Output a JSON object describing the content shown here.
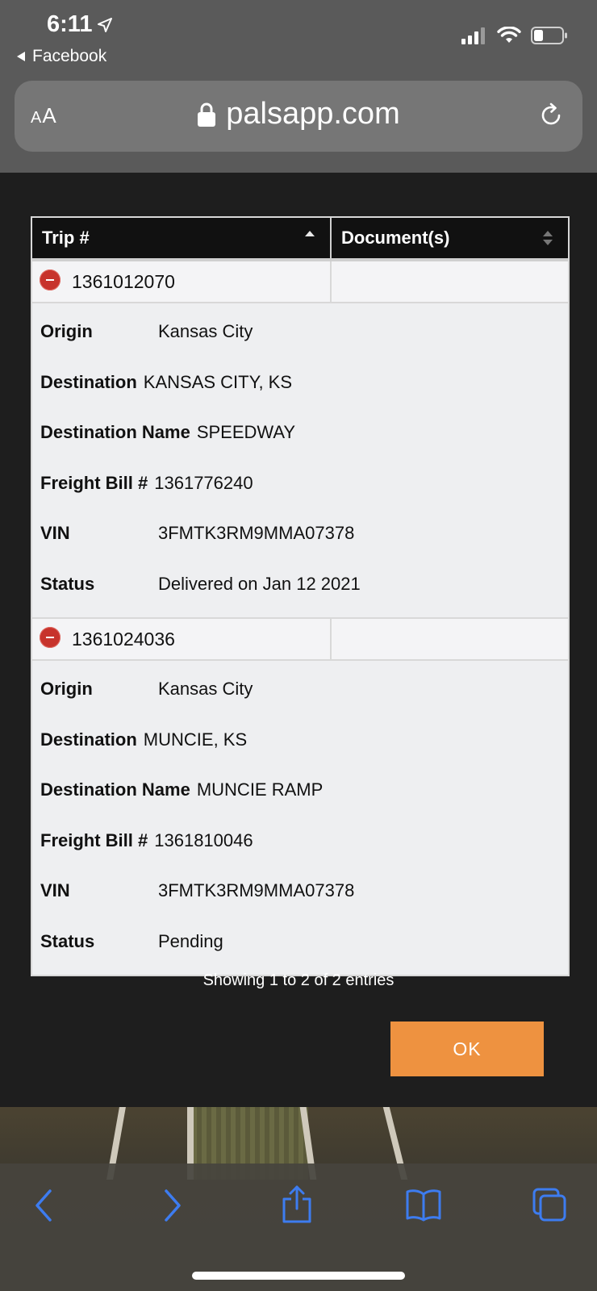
{
  "status_bar": {
    "time": "6:11",
    "back_app": "Facebook"
  },
  "browser": {
    "text_size_label_small": "A",
    "text_size_label_large": "A",
    "url": "palsapp.com"
  },
  "table": {
    "headers": {
      "trip": "Trip #",
      "documents": "Document(s)"
    },
    "trips": [
      {
        "trip_number": "1361012070",
        "details": [
          {
            "label": "Origin",
            "value": "Kansas City"
          },
          {
            "label": "Destination",
            "value": "KANSAS CITY, KS"
          },
          {
            "label": "Destination Name",
            "value": "SPEEDWAY"
          },
          {
            "label": "Freight Bill #",
            "value": "1361776240"
          },
          {
            "label": "VIN",
            "value": "3FMTK3RM9MMA07378"
          },
          {
            "label": "Status",
            "value": "Delivered on Jan 12 2021"
          }
        ]
      },
      {
        "trip_number": "1361024036",
        "details": [
          {
            "label": "Origin",
            "value": "Kansas City"
          },
          {
            "label": "Destination",
            "value": "MUNCIE, KS"
          },
          {
            "label": "Destination Name",
            "value": "MUNCIE RAMP"
          },
          {
            "label": "Freight Bill #",
            "value": "1361810046"
          },
          {
            "label": "VIN",
            "value": "3FMTK3RM9MMA07378"
          },
          {
            "label": "Status",
            "value": "Pending"
          }
        ]
      }
    ]
  },
  "footer": {
    "showing": "Showing 1 to 2 of 2 entries",
    "ok_label": "OK"
  },
  "colors": {
    "accent_orange": "#ee9240",
    "collapse_red": "#c7332c",
    "ios_blue": "#3d7cf0"
  },
  "icons": [
    "location-arrow-icon",
    "signal-icon",
    "wifi-icon",
    "battery-icon",
    "lock-icon",
    "reload-icon",
    "sort-asc-icon",
    "sort-both-icon",
    "collapse-minus-icon",
    "back-icon",
    "forward-icon",
    "share-icon",
    "bookmarks-icon",
    "tabs-icon"
  ]
}
